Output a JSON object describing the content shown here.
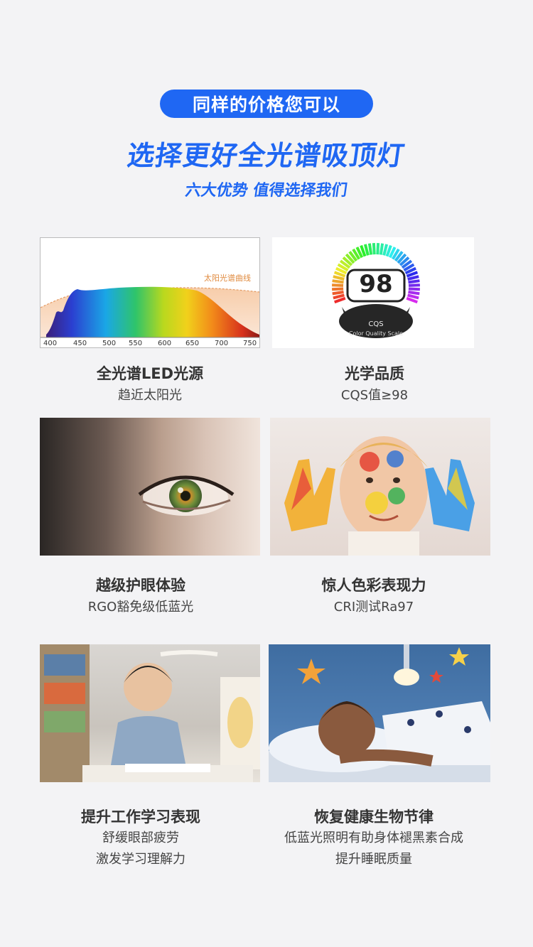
{
  "header": {
    "pill_text": "同样的价格您可以",
    "headline": "选择更好全光谱吸顶灯",
    "subline": "六大优势 值得选择我们"
  },
  "spectrum": {
    "curve_label": "太阳光谱曲线",
    "axis_ticks": [
      "400",
      "450",
      "500",
      "550",
      "600",
      "650",
      "700",
      "750"
    ]
  },
  "cqs": {
    "score": "98",
    "label": "CQS",
    "ring_text": "Color Quality Scale"
  },
  "features": [
    {
      "title": "全光谱LED光源",
      "lines": [
        "趋近太阳光"
      ]
    },
    {
      "title": "光学品质",
      "lines": [
        "CQS值≥98"
      ]
    },
    {
      "title": "越级护眼体验",
      "lines": [
        "RGO豁免级低蓝光"
      ]
    },
    {
      "title": "惊人色彩表现力",
      "lines": [
        "CRI测试Ra97"
      ]
    },
    {
      "title": "提升工作学习表现",
      "lines": [
        "舒缓眼部疲劳",
        "激发学习理解力"
      ]
    },
    {
      "title": "恢复健康生物节律",
      "lines": [
        "低蓝光照明有助身体褪黑素合成",
        "提升睡眠质量"
      ]
    }
  ]
}
